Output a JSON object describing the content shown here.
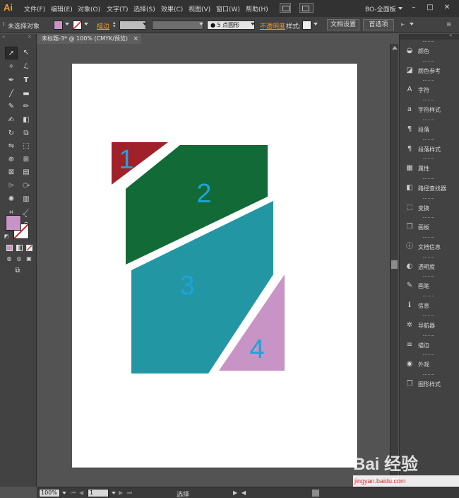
{
  "app": {
    "logo": "Ai",
    "workspace": "BO-全面板"
  },
  "menu": [
    "文件(F)",
    "编辑(E)",
    "对象(O)",
    "文字(T)",
    "选择(S)",
    "效果(C)",
    "视图(V)",
    "窗口(W)",
    "帮助(H)"
  ],
  "window_controls": {
    "minimize": "–",
    "maximize": "□",
    "close": "✕"
  },
  "controlbar": {
    "selection": "未选择对象",
    "stroke_label": "描边",
    "brush_label": "5 点圆形",
    "opacity_label": "不透明度",
    "style_label": "样式:",
    "doc_setup": "文档设置",
    "preferences": "首选项",
    "fill_color": "#c893c5",
    "accent_orange": "#f29b2a"
  },
  "document": {
    "tab_title": "未标题-3* @ 100% (CMYK/预览)",
    "close": "×"
  },
  "artwork": {
    "shapes": [
      {
        "label": "1",
        "color": "#a0212a"
      },
      {
        "label": "2",
        "color": "#126a37"
      },
      {
        "label": "3",
        "color": "#2396a4"
      },
      {
        "label": "4",
        "color": "#c893c5"
      }
    ],
    "label_color": "#1da3db"
  },
  "status": {
    "zoom": "100%",
    "page": "1",
    "tool_status": "选择"
  },
  "panels": [
    {
      "label": "颜色",
      "icon": "color-icon",
      "glyph": "◒"
    },
    {
      "label": "颜色参考",
      "icon": "color-guide-icon",
      "glyph": "◪"
    },
    {
      "label": "字符",
      "icon": "character-icon",
      "glyph": "A"
    },
    {
      "label": "字符样式",
      "icon": "character-style-icon",
      "glyph": "a"
    },
    {
      "label": "段落",
      "icon": "paragraph-icon",
      "glyph": "¶"
    },
    {
      "label": "段落样式",
      "icon": "paragraph-style-icon",
      "glyph": "¶"
    },
    {
      "label": "属性",
      "icon": "attributes-icon",
      "glyph": "▦"
    },
    {
      "label": "路径查找器",
      "icon": "pathfinder-icon",
      "glyph": "◧"
    },
    {
      "label": "变换",
      "icon": "transform-icon",
      "glyph": "⬚"
    },
    {
      "label": "画板",
      "icon": "artboards-icon",
      "glyph": "❐"
    },
    {
      "label": "文档信息",
      "icon": "document-info-icon",
      "glyph": "ⓘ"
    },
    {
      "label": "透明度",
      "icon": "transparency-icon",
      "glyph": "◐"
    },
    {
      "label": "画笔",
      "icon": "brushes-icon",
      "glyph": "✎"
    },
    {
      "label": "信息",
      "icon": "info-icon",
      "glyph": "ℹ"
    },
    {
      "label": "导航器",
      "icon": "navigator-icon",
      "glyph": "✲"
    },
    {
      "label": "描边",
      "icon": "stroke-icon",
      "glyph": "≡"
    },
    {
      "label": "外观",
      "icon": "appearance-icon",
      "glyph": "◉"
    },
    {
      "label": "图形样式",
      "icon": "graphic-styles-icon",
      "glyph": "❐"
    }
  ],
  "watermark": {
    "main": "Bai 经验",
    "sub": "jingyan.baidu.com"
  }
}
